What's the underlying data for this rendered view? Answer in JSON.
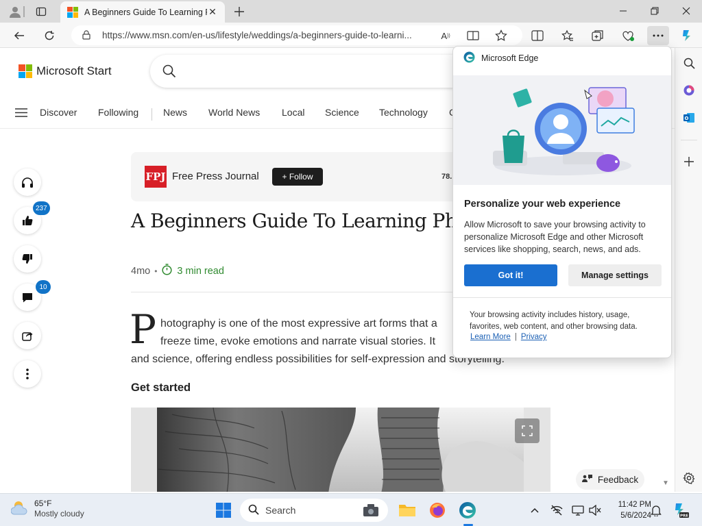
{
  "browser": {
    "tab_title": "A Beginners Guide To Learning P",
    "url": "https://www.msn.com/en-us/lifestyle/weddings/a-beginners-guide-to-learni...",
    "reader_icon_label": "A"
  },
  "msn": {
    "logo_text": "Microsoft Start",
    "nav_items": [
      "Discover",
      "Following",
      "News",
      "World News",
      "Local",
      "Science",
      "Technology",
      "C"
    ],
    "like_count": "237",
    "comment_count": "10",
    "publisher": "Free Press Journal",
    "publisher_logo": "FPJ",
    "follow_label": "+ Follow",
    "followers": "78.",
    "headline": "A Beginners Guide To Learning Photo",
    "age": "4mo",
    "dot": "•",
    "read_time": "3 min read",
    "drop_cap": "P",
    "body_line1": "hotography is one of the most expressive art forms that a",
    "body_line2": "freeze time, evoke emotions and narrate visual stories. It",
    "body_line3": "and science, offering endless possibilities for self-expression and storytelling.",
    "section_heading": "Get started",
    "feedback_label": "Feedback"
  },
  "popup": {
    "title": "Microsoft Edge",
    "heading": "Personalize your web experience",
    "description": "Allow Microsoft to save your browsing activity to personalize Microsoft Edge and other Microsoft services like shopping, search, news, and ads.",
    "primary_button": "Got it!",
    "secondary_button": "Manage settings",
    "footer": "Your browsing activity includes history, usage, favorites, web content, and other browsing data.",
    "learn_more": "Learn More",
    "separator": "|",
    "privacy": "Privacy"
  },
  "taskbar": {
    "temperature": "65°F",
    "condition": "Mostly cloudy",
    "search_label": "Search",
    "time": "11:42 PM",
    "date": "5/6/2024"
  },
  "colors": {
    "accent_blue": "#1a6fd0",
    "badge_blue": "#1173c7",
    "fpj_red": "#d71f27",
    "read_time_green": "#2f8a2f"
  }
}
